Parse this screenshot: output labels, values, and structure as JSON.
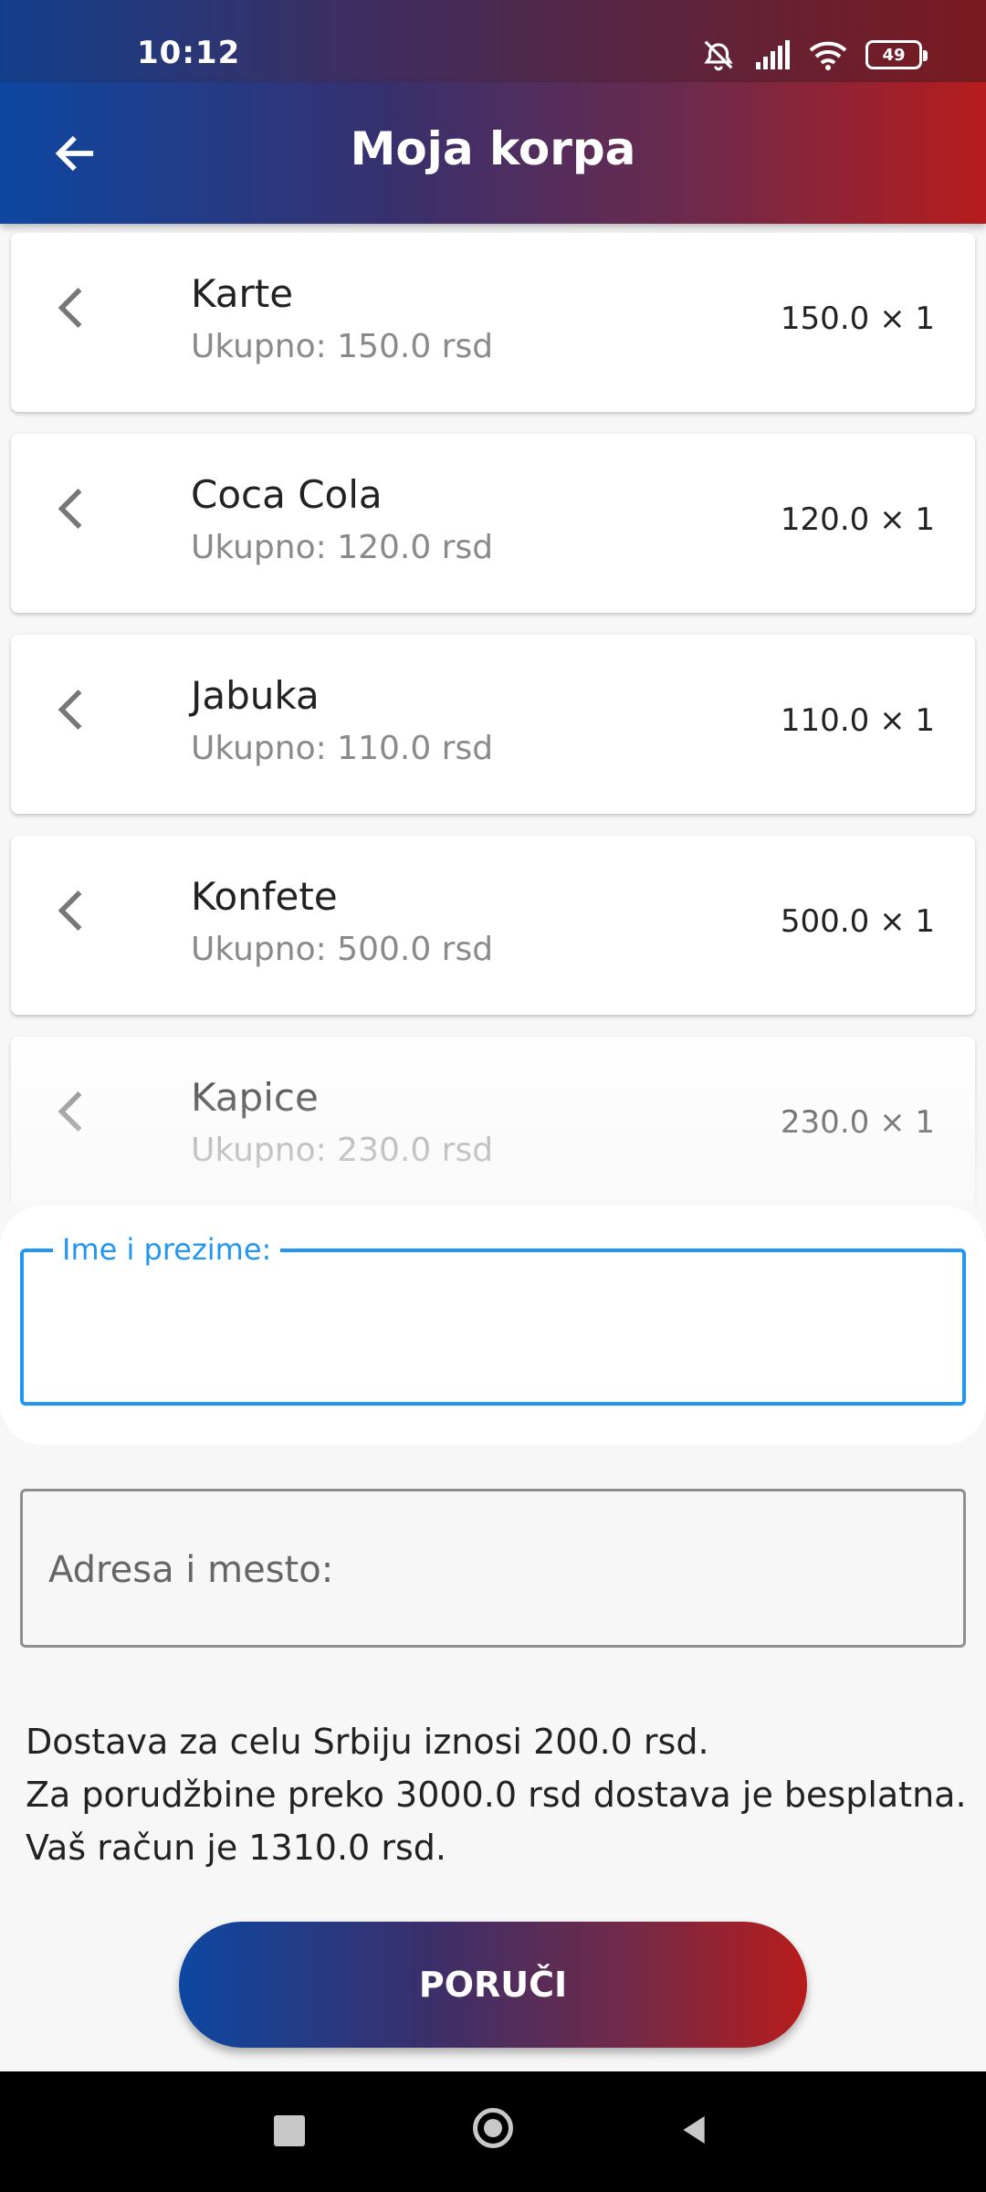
{
  "status_bar": {
    "time": "10:12",
    "battery": "49",
    "icons": [
      "alarm-off-icon",
      "signal-icon",
      "wifi-icon",
      "battery-icon"
    ]
  },
  "app_bar": {
    "title": "Moja korpa",
    "back_icon": "arrow-left-icon"
  },
  "cart": {
    "items": [
      {
        "name": "Karte",
        "total": "Ukupno: 150.0 rsd",
        "qty": "150.0 × 1"
      },
      {
        "name": "Coca Cola",
        "total": "Ukupno: 120.0 rsd",
        "qty": "120.0 × 1"
      },
      {
        "name": "Jabuka",
        "total": "Ukupno: 110.0 rsd",
        "qty": "110.0 × 1"
      },
      {
        "name": "Konfete",
        "total": "Ukupno: 500.0 rsd",
        "qty": "500.0 × 1"
      },
      {
        "name": "Kapice",
        "total": "Ukupno: 230.0 rsd",
        "qty": "230.0 × 1"
      }
    ]
  },
  "form": {
    "name_label": "Ime i prezime:",
    "name_value": "",
    "address_placeholder": "Adresa i mesto:",
    "address_value": ""
  },
  "info": {
    "line1": "Dostava za celu Srbiju iznosi 200.0 rsd.",
    "line2": "Za porudžbine preko 3000.0 rsd dostava je besplatna.",
    "line3": "Vaš račun je 1310.0 rsd."
  },
  "order_button": "PORUČI",
  "colors": {
    "gradient_start": "#0d47a1",
    "gradient_end": "#b71c1c",
    "focus_blue": "#2196f3"
  }
}
